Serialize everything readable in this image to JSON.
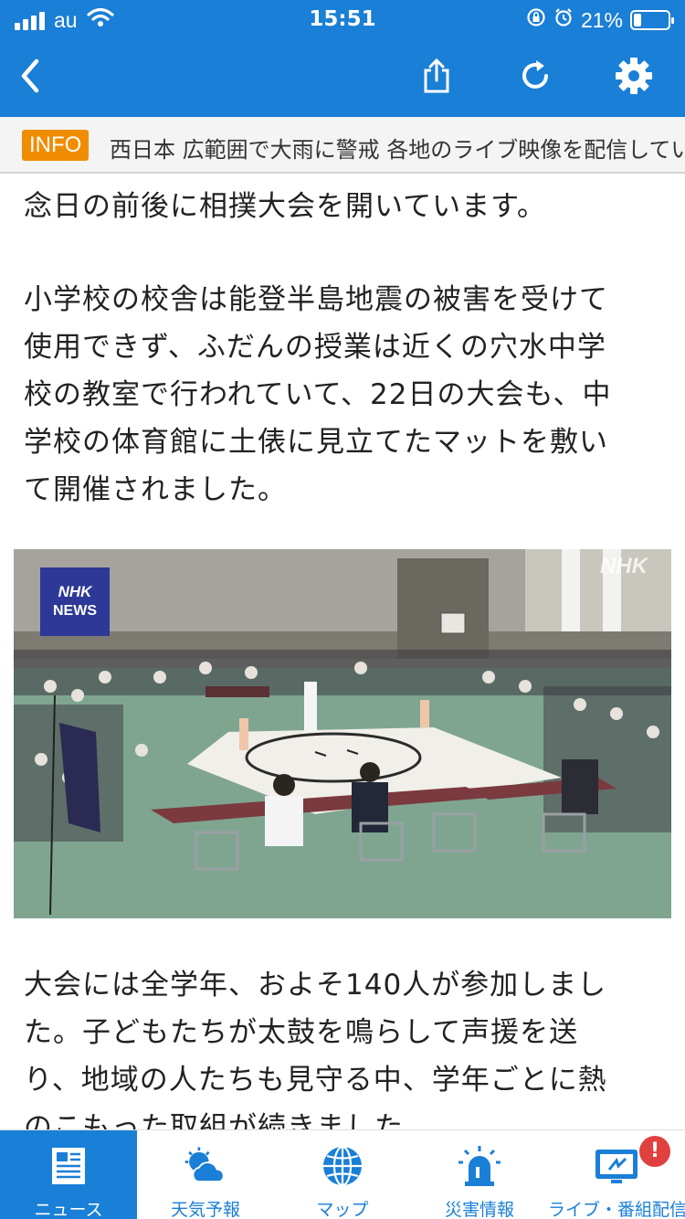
{
  "status_bar": {
    "carrier": "au",
    "time": "15:51",
    "battery": "21%",
    "battery_level": 0.21
  },
  "nav": {
    "back_icon": "chevron-left-icon",
    "share_icon": "share-icon",
    "reload_icon": "reload-icon",
    "settings_icon": "gear-icon"
  },
  "info_bar": {
    "badge": "INFO",
    "text": "西日本 広範囲で大雨に警戒 各地のライブ映像を配信してい"
  },
  "article": {
    "para1": [
      "念日の前後に相撲大会を開いています。"
    ],
    "para2": [
      "小学校の校舎は能登半島地震の被害を受けて",
      "使用できず、ふだんの授業は近くの穴水中学",
      "校の教室で行われていて、22日の大会も、中",
      "学校の体育館に土俵に見立てたマットを敷い",
      "て開催されました。"
    ],
    "photo": {
      "logo_top": "NHK",
      "logo_bottom": "NEWS",
      "watermark": "NHK"
    },
    "para3": [
      "大会には全学年、およそ140人が参加しまし",
      "た。子どもたちが太鼓を鳴らして声援を送",
      "り、地域の人たちも見守る中、学年ごとに熱",
      "のこもった取組が続きました。"
    ]
  },
  "tabs": [
    {
      "label": "ニュース",
      "icon": "newspaper-icon",
      "active": true
    },
    {
      "label": "天気予報",
      "icon": "weather-icon",
      "active": false
    },
    {
      "label": "マップ",
      "icon": "globe-icon",
      "active": false
    },
    {
      "label": "災害情報",
      "icon": "siren-icon",
      "active": false
    },
    {
      "label": "ライブ・番組配信",
      "icon": "tv-icon",
      "active": false,
      "badge": "!"
    }
  ],
  "colors": {
    "accent": "#1a7fd6",
    "info_badge": "#f08c00",
    "alert_badge": "#e0403e"
  }
}
